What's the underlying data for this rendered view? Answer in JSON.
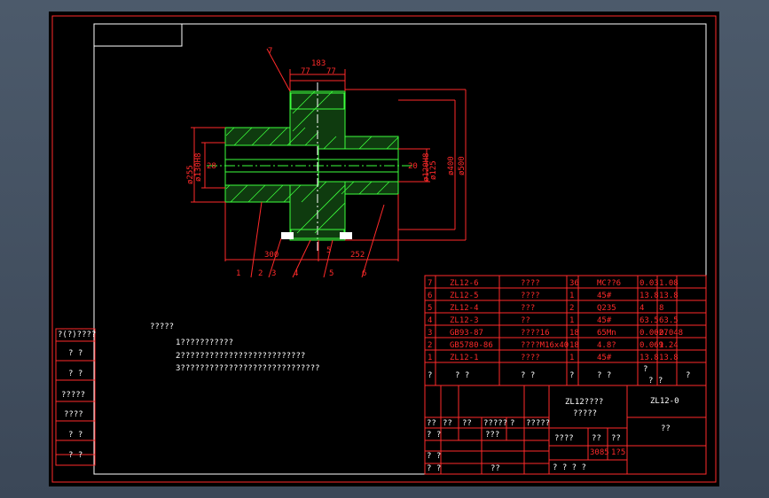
{
  "drawing": {
    "dimensions": {
      "d183": "183",
      "d77a": "77",
      "d77b": "77",
      "d300": "300",
      "d252": "252",
      "d5": "5",
      "d28": "28",
      "d20": "20",
      "phi255": "ø255",
      "phi130h8": "ø130H8",
      "phi125": "ø125",
      "phi120h8": "ø120H8",
      "phi400": "ø400",
      "phi500": "ø500"
    },
    "balloons": [
      "7",
      "1",
      "2",
      "3",
      "4",
      "5",
      "6"
    ],
    "notes": {
      "title": "?????",
      "items": [
        "1???????????",
        "2??????????????????????????",
        "3?????????????????????????????"
      ]
    },
    "left_strip": [
      "?(?)????",
      "?  ?",
      "?  ?",
      "?????",
      "????",
      "?  ?",
      "?  ?"
    ],
    "bom": {
      "rows": [
        {
          "no": "7",
          "code": "ZL12-6",
          "name": "????",
          "qty": "36",
          "material": "MC??6",
          "w1": "0.03",
          "w2": "1.08"
        },
        {
          "no": "6",
          "code": "ZL12-5",
          "name": "????",
          "qty": "1",
          "material": "45#",
          "w1": "13.8",
          "w2": "13.8"
        },
        {
          "no": "5",
          "code": "ZL12-4",
          "name": "???",
          "qty": "2",
          "material": "Q235",
          "w1": "4",
          "w2": "8"
        },
        {
          "no": "4",
          "code": "ZL12-3",
          "name": "??",
          "qty": "1",
          "material": "45#",
          "w1": "63.5",
          "w2": "63.5"
        },
        {
          "no": "3",
          "code": "GB93-87",
          "name": "????16",
          "qty": "18",
          "material": "65Mn",
          "w1": "0.0027",
          "w2": "0.048"
        },
        {
          "no": "2",
          "code": "GB5780-86",
          "name": "????M16x40",
          "qty": "18",
          "material": "4.8?",
          "w1": "0.069",
          "w2": "1.24"
        },
        {
          "no": "1",
          "code": "ZL12-1",
          "name": "????",
          "qty": "1",
          "material": "45#",
          "w1": "13.8",
          "w2": "13.8"
        }
      ],
      "header": [
        "?",
        "?  ?",
        "?  ?",
        "?",
        "?  ?",
        "?",
        "?  ?",
        "?"
      ]
    },
    "title_block": {
      "drawing_name": "ZL12????",
      "drawing_sub": "?????",
      "drawing_no": "ZL12-0",
      "unit": "??",
      "sign_cols": [
        "??",
        "??",
        "??",
        "?????",
        "?",
        "?????"
      ],
      "rows_left": [
        "?  ?",
        "?  ?",
        "?  ?"
      ],
      "approve": "???",
      "stage": "????",
      "weight": "??",
      "scale": "??",
      "mass": "3085",
      "ratio": "1?5",
      "sheets": "?   ?   ?   ?",
      "check": "??"
    }
  }
}
